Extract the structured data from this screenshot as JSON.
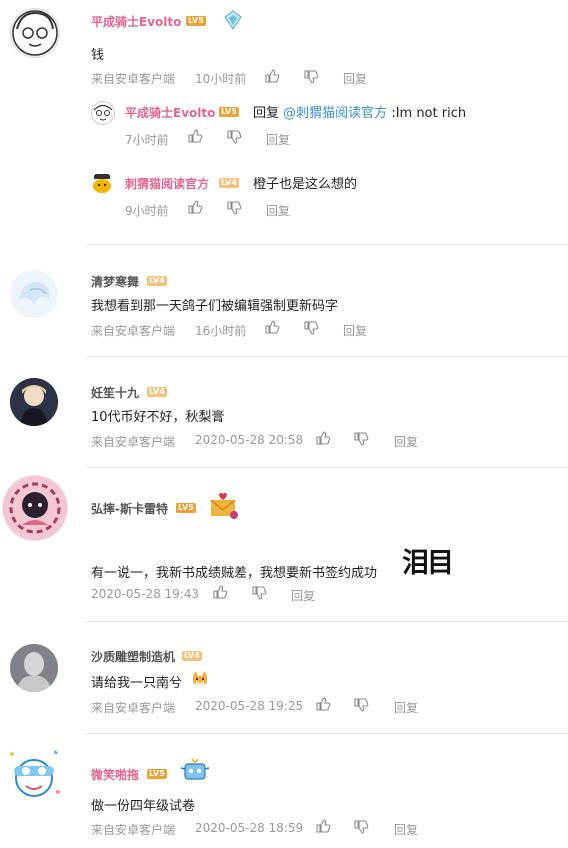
{
  "comments": [
    {
      "username": "平成骑士Evolto",
      "level": "LV5",
      "content": "钱",
      "source": "来自安卓客户端",
      "time": "10小时前",
      "reply": "回复",
      "subreplies": [
        {
          "username": "平成骑士Evolto",
          "level": "LV5",
          "reply_prefix": "回复",
          "mention": "@刺猬猫阅读官方",
          "content": ":Im not rich",
          "time": "7小时前",
          "reply": "回复"
        },
        {
          "username": "刺猬猫阅读官方",
          "level": "LV4",
          "content": "橙子也是这么想的",
          "time": "9小时前",
          "reply": "回复"
        }
      ]
    },
    {
      "username": "清梦寒舞",
      "level": "LV4",
      "content": "我想看到那一天鸽子们被编辑强制更新码字",
      "source": "来自安卓客户端",
      "time": "16小时前",
      "reply": "回复"
    },
    {
      "username": "妊笙十九",
      "level": "LV4",
      "content": "10代币好不好，秋梨膏",
      "source": "来自安卓客户端",
      "time": "2020-05-28 20:58",
      "reply": "回复"
    },
    {
      "username": "弘摔-斯卡雷特",
      "level": "LV5",
      "content": "有一说一，我新书成绩贼差，我想要新书签约成功",
      "sticker_text": "泪目",
      "time": "2020-05-28 19:43",
      "reply": "回复"
    },
    {
      "username": "沙质雕塑制造机",
      "level": "LV4",
      "content": "请给我一只南兮",
      "source": "来自安卓客户端",
      "time": "2020-05-28 19:25",
      "reply": "回复"
    },
    {
      "username": "微笑啪拖",
      "level": "LV5",
      "content": "做一份四年级试卷",
      "source": "来自安卓客户端",
      "time": "2020-05-28 18:59",
      "reply": "回复"
    }
  ],
  "colors": {
    "pink_name": "#e5658f",
    "gray_name": "#555555",
    "mention": "#3a8fd6",
    "meta": "#999999"
  },
  "icons": [
    "thumbs-up-icon",
    "thumbs-down-icon"
  ]
}
